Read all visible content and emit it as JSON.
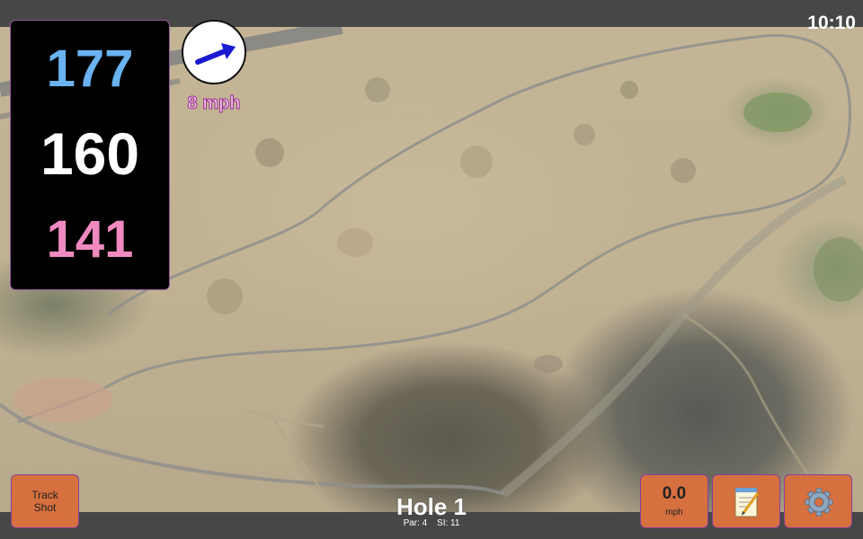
{
  "status": {
    "time": "10:10"
  },
  "distances": {
    "back": "177",
    "middle": "160",
    "front": "141"
  },
  "wind": {
    "speed_label": "8 mph",
    "direction_icon": "arrow-right-icon"
  },
  "hole": {
    "title": "Hole 1",
    "par_label": "Par: 4",
    "si_label": "SI: 11"
  },
  "buttons": {
    "track_shot": "Track Shot",
    "speed_value": "0.0",
    "speed_unit": "mph",
    "notes_icon": "notepad-icon",
    "settings_icon": "gear-icon"
  },
  "colors": {
    "back_distance": "#6ab2f0",
    "middle_distance": "#ffffff",
    "front_distance": "#f08ac0",
    "button_bg": "#d6703e",
    "wind_arrow": "#1a1ad0"
  }
}
